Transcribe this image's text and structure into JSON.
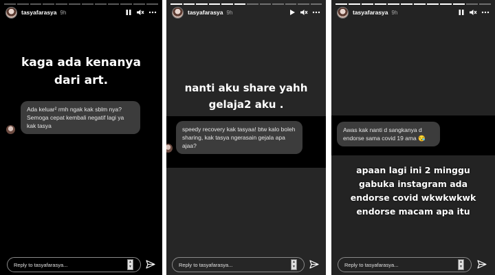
{
  "username": "tasyafarasya",
  "time": "9h",
  "reply_placeholder": "Reply to tasyafarasya...",
  "panels": [
    {
      "story_text": "kaga ada kenanya dari art.",
      "question": "Ada keluar² rmh ngak kak sblm nya? Semoga cepat kembali negatif lagi ya kak tasya",
      "playback": "paused"
    },
    {
      "story_text": "nanti aku share yahh gelaja2 aku .",
      "question": "speedy recovery kak tasyaa! btw kalo boleh sharing, kak tasya ngerasain gejala apa ajaa?",
      "playback": "playing"
    },
    {
      "question": "Awas kak nanti d sangkanya d endorse sama covid 19 ama",
      "question_emoji": "😪",
      "story_text": "apaan lagi ini 2 minggu gabuka instagram ada endorse covid wkwkwkwk endorse macam apa itu",
      "playback": "paused"
    }
  ],
  "icons": [
    "pause-icon",
    "play-icon",
    "volume-icon",
    "more-icon",
    "send-icon"
  ]
}
